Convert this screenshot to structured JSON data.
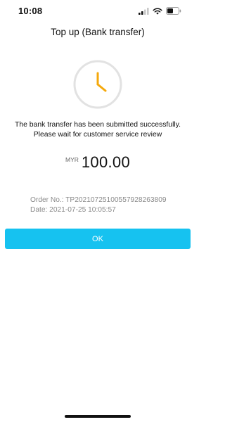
{
  "status_bar": {
    "time": "10:08",
    "icons": [
      "signal-icon",
      "wifi-icon",
      "battery-icon"
    ]
  },
  "header": {
    "title": "Top up (Bank transfer)"
  },
  "status_graphic": {
    "icon": "clock-icon",
    "ring_color": "#e2e2e2",
    "hands_color": "#f5a90c"
  },
  "result": {
    "message_line1": "The bank transfer has been submitted successfully.",
    "message_line2": "Please wait for customer service review",
    "currency": "MYR",
    "amount": "100.00",
    "order_no": "Order No.: TP20210725100557928263809",
    "date": "Date: 2021-07-25 10:05:57"
  },
  "actions": {
    "ok_label": "OK",
    "ok_color": "#16c2f0"
  }
}
